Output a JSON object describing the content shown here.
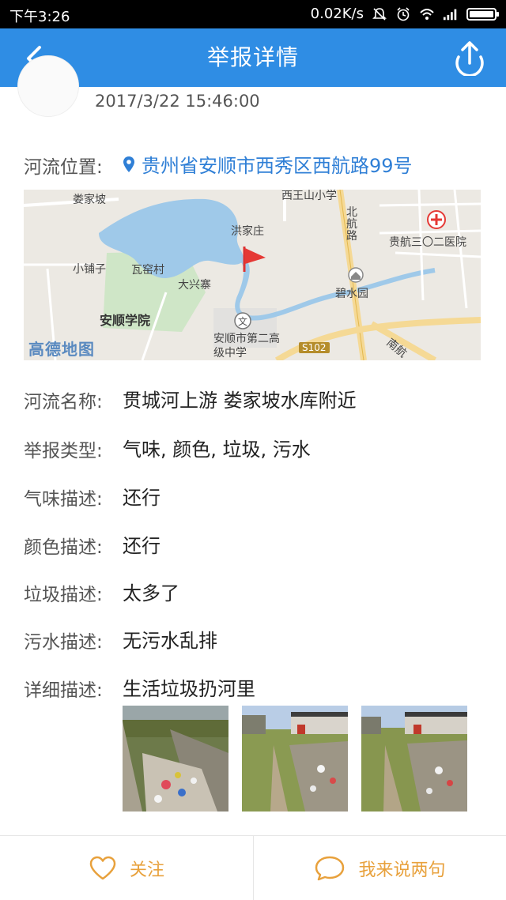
{
  "status_bar": {
    "time": "下午3:26",
    "speed": "0.02K/s"
  },
  "header": {
    "title": "举报详情"
  },
  "report": {
    "datetime": "2017/3/22 15:46:00",
    "location_label": "河流位置:",
    "location_value": "贵州省安顺市西秀区西航路99号",
    "river_name_label": "河流名称:",
    "river_name_value": "贯城河上游 娄家坡水库附近",
    "type_label": "举报类型:",
    "type_value": "气味, 颜色, 垃圾, 污水",
    "smell_label": "气味描述:",
    "smell_value": "还行",
    "color_label": "颜色描述:",
    "color_value": "还行",
    "garbage_label": "垃圾描述:",
    "garbage_value": "太多了",
    "sewage_label": "污水描述:",
    "sewage_value": "无污水乱排",
    "detail_label": "详细描述:",
    "detail_value": "生活垃圾扔河里"
  },
  "map": {
    "labels": {
      "loujiapo": "娄家坡",
      "xiwangshan": "西王山小学",
      "hongjiazhuang": "洪家庄",
      "beihanglu": "北航路",
      "hospital": "贵航三〇二医院",
      "xiaopuzi": "小铺子",
      "wayaocun": "瓦窑村",
      "daxingzhai": "大兴寨",
      "bishuiyuan": "碧水园",
      "college": "安顺学院",
      "school": "安顺市第二高级中学",
      "road": "S102",
      "nanhang": "南航",
      "logo": "高德地图"
    }
  },
  "bottom_bar": {
    "follow_label": "关注",
    "comment_label": "我来说两句"
  },
  "colors": {
    "nav": "#2f8de4",
    "accent": "#e8a13c",
    "link": "#2f7fd6"
  }
}
